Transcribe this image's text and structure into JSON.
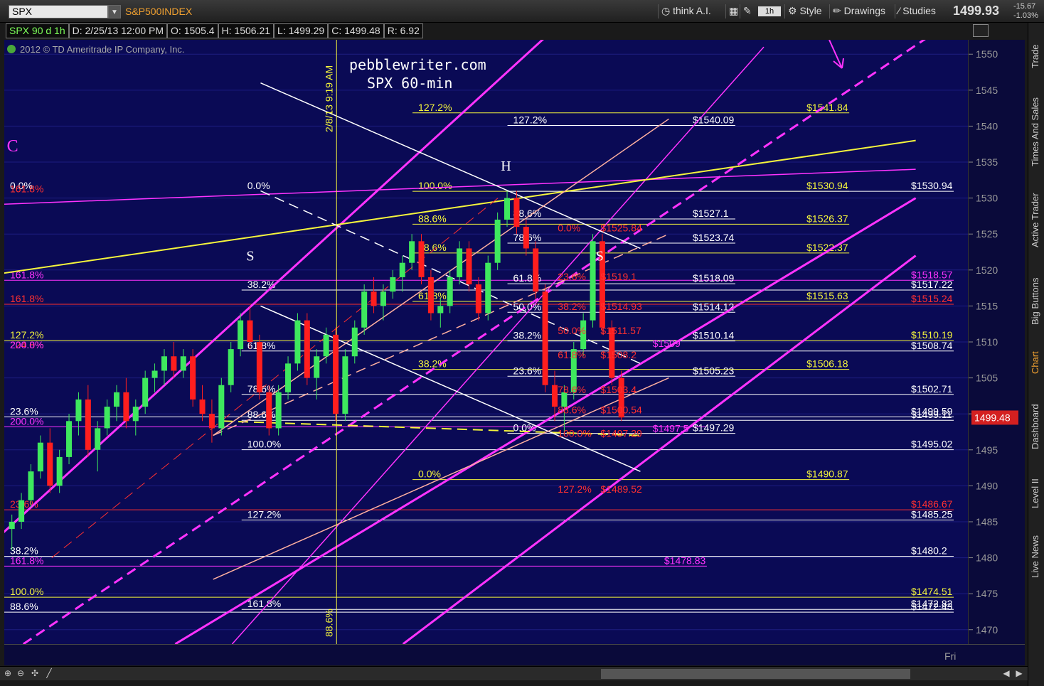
{
  "toolbar": {
    "symbol": "SPX",
    "symbol_name": "S&P500INDEX",
    "think_ai": "think A.I.",
    "interval": "1h",
    "style": "Style",
    "drawings": "Drawings",
    "studies": "Studies",
    "last_price": "1499.93",
    "change": "-15.67",
    "change_pct": "-1.03%"
  },
  "infobar": {
    "sym": "SPX 90 d 1h",
    "date": "D: 2/25/13 12:00 PM",
    "open": "O: 1505.4",
    "high": "H: 1506.21",
    "low": "L: 1499.29",
    "close": "C: 1499.48",
    "range": "R: 6.92"
  },
  "sidebar": [
    "Trade",
    "Times And Sales",
    "Active Trader",
    "Big Buttons",
    "Chart",
    "Dashboard",
    "Level II",
    "Live News"
  ],
  "colors": {
    "bg": "#0a0a55",
    "up": "#3ee85e",
    "down": "#ff1e1e",
    "magenta": "#ff33ff",
    "yellow": "#f5f53c",
    "white": "#ffffff",
    "salmon": "#ffb0a0",
    "red": "#ff3030",
    "current_price_box": "#d42020"
  },
  "chart_data": {
    "type": "candlestick",
    "title": "pebblewriter.com",
    "subtitle": "SPX 60-min",
    "copyright": "2012 © TD Ameritrade IP Company, Inc.",
    "x_axis_label": "Fri",
    "y_ticks": [
      1470,
      1475,
      1480,
      1485,
      1490,
      1495,
      1500,
      1505,
      1510,
      1515,
      1520,
      1525,
      1530,
      1535,
      1540,
      1545,
      1550
    ],
    "ylim": [
      1468,
      1552
    ],
    "current_price": 1499.48,
    "pattern_labels": [
      {
        "text": "C",
        "x": 0.27,
        "y": 1536.5,
        "color": "#ff33ff"
      },
      {
        "text": "S",
        "x": 25.5,
        "y": 1521.3,
        "color": "#ffffff"
      },
      {
        "text": "H",
        "x": 52.3,
        "y": 1533.8,
        "color": "#ffffff"
      },
      {
        "text": "S",
        "x": 62.3,
        "y": 1521.3,
        "color": "#ffffff"
      }
    ],
    "vertical_marker": {
      "label": "2/8/13 9:19 AM",
      "label_bottom": "88.6%",
      "x": 35.0
    },
    "candles": [
      [
        1484,
        1486,
        1481,
        1485
      ],
      [
        1485,
        1489,
        1484,
        1488
      ],
      [
        1488,
        1493,
        1487,
        1492
      ],
      [
        1492,
        1497,
        1491,
        1496
      ],
      [
        1496,
        1498,
        1489,
        1490
      ],
      [
        1490,
        1495,
        1489,
        1494
      ],
      [
        1494,
        1500,
        1493,
        1499
      ],
      [
        1499,
        1503,
        1497,
        1502
      ],
      [
        1502,
        1504,
        1494,
        1495
      ],
      [
        1495,
        1499,
        1492,
        1498
      ],
      [
        1498,
        1502,
        1497,
        1501
      ],
      [
        1501,
        1504,
        1499,
        1503
      ],
      [
        1503,
        1505,
        1498,
        1499
      ],
      [
        1499,
        1502,
        1497,
        1501
      ],
      [
        1501,
        1506,
        1500,
        1505
      ],
      [
        1505,
        1507,
        1503,
        1506
      ],
      [
        1506,
        1509,
        1504,
        1508
      ],
      [
        1508,
        1510,
        1505,
        1506
      ],
      [
        1506,
        1509,
        1505,
        1508
      ],
      [
        1508,
        1509,
        1501,
        1502
      ],
      [
        1502,
        1504,
        1499,
        1500
      ],
      [
        1500,
        1502,
        1496,
        1498
      ],
      [
        1498,
        1505,
        1497,
        1504
      ],
      [
        1504,
        1510,
        1503,
        1509
      ],
      [
        1509,
        1514,
        1508,
        1513
      ],
      [
        1513,
        1515,
        1509,
        1510
      ],
      [
        1510,
        1511,
        1502,
        1503
      ],
      [
        1503,
        1504,
        1497,
        1498
      ],
      [
        1498,
        1504,
        1497,
        1503
      ],
      [
        1503,
        1508,
        1502,
        1507
      ],
      [
        1507,
        1514,
        1506,
        1513
      ],
      [
        1513,
        1514,
        1504,
        1505
      ],
      [
        1505,
        1509,
        1502,
        1508
      ],
      [
        1508,
        1512,
        1507,
        1511
      ],
      [
        1511,
        1512,
        1499,
        1500
      ],
      [
        1500,
        1509,
        1499,
        1508
      ],
      [
        1508,
        1513,
        1507,
        1512
      ],
      [
        1512,
        1518,
        1511,
        1517
      ],
      [
        1517,
        1519,
        1514,
        1515
      ],
      [
        1515,
        1518,
        1513,
        1517
      ],
      [
        1517,
        1520,
        1516,
        1519
      ],
      [
        1519,
        1522,
        1517,
        1521
      ],
      [
        1521,
        1525,
        1520,
        1524
      ],
      [
        1524,
        1525,
        1518,
        1519
      ],
      [
        1519,
        1520,
        1513,
        1514
      ],
      [
        1514,
        1516,
        1512,
        1515
      ],
      [
        1515,
        1520,
        1514,
        1519
      ],
      [
        1519,
        1524,
        1518,
        1523
      ],
      [
        1523,
        1524,
        1517,
        1518
      ],
      [
        1518,
        1519,
        1513,
        1514
      ],
      [
        1514,
        1522,
        1513,
        1521
      ],
      [
        1521,
        1528,
        1520,
        1527
      ],
      [
        1527,
        1531,
        1526,
        1530
      ],
      [
        1530,
        1531,
        1525,
        1526
      ],
      [
        1526,
        1527,
        1522,
        1523
      ],
      [
        1523,
        1524,
        1516,
        1517
      ],
      [
        1517,
        1518,
        1503,
        1504
      ],
      [
        1504,
        1506,
        1499,
        1501
      ],
      [
        1501,
        1504,
        1497,
        1503
      ],
      [
        1503,
        1510,
        1502,
        1509
      ],
      [
        1509,
        1514,
        1508,
        1513
      ],
      [
        1513,
        1525,
        1512,
        1524
      ],
      [
        1524,
        1525,
        1511,
        1512
      ],
      [
        1512,
        1513,
        1504,
        1505
      ],
      [
        1505,
        1506,
        1499,
        1499.5
      ]
    ],
    "trendlines": [
      {
        "color": "#ff33ff",
        "width": 3,
        "dash": false,
        "points": [
          [
            -3,
            1480
          ],
          [
            60,
            1556
          ]
        ]
      },
      {
        "color": "#ff33ff",
        "width": 3,
        "dash": false,
        "points": [
          [
            18,
            1468
          ],
          [
            96,
            1530
          ]
        ]
      },
      {
        "color": "#ff33ff",
        "width": 3,
        "dash": false,
        "points": [
          [
            42,
            1468
          ],
          [
            96,
            1522
          ]
        ]
      },
      {
        "color": "#ff33ff",
        "width": 1.5,
        "dash": false,
        "points": [
          [
            24,
            1468
          ],
          [
            80,
            1551
          ]
        ]
      },
      {
        "color": "#ff33ff",
        "width": 3,
        "dash": true,
        "points": [
          [
            2,
            1468
          ],
          [
            98,
            1553
          ]
        ]
      },
      {
        "color": "#ff33ff",
        "width": 1.5,
        "dash": false,
        "points": [
          [
            -3,
            1529
          ],
          [
            96,
            1534
          ]
        ]
      },
      {
        "color": "#f5f53c",
        "width": 2,
        "dash": false,
        "points": [
          [
            -3,
            1519
          ],
          [
            96,
            1538
          ]
        ]
      },
      {
        "color": "#f5f53c",
        "width": 2,
        "dash": true,
        "points": [
          [
            23,
            1499
          ],
          [
            67,
            1497
          ]
        ]
      },
      {
        "color": "#ffffff",
        "width": 1.5,
        "dash": false,
        "points": [
          [
            27,
            1546
          ],
          [
            67,
            1523
          ]
        ]
      },
      {
        "color": "#ffffff",
        "width": 1.5,
        "dash": false,
        "points": [
          [
            27,
            1515
          ],
          [
            67,
            1492
          ]
        ]
      },
      {
        "color": "#ffffff",
        "width": 1.5,
        "dash": true,
        "points": [
          [
            27,
            1531
          ],
          [
            67,
            1507
          ]
        ]
      },
      {
        "color": "#ffb0a0",
        "width": 1.5,
        "dash": false,
        "points": [
          [
            22,
            1477
          ],
          [
            70,
            1505
          ]
        ]
      },
      {
        "color": "#ffb0a0",
        "width": 1.5,
        "dash": false,
        "points": [
          [
            22,
            1497
          ],
          [
            70,
            1541
          ]
        ]
      },
      {
        "color": "#ffb0a0",
        "width": 1.5,
        "dash": true,
        "points": [
          [
            22,
            1497
          ],
          [
            70,
            1525
          ]
        ]
      },
      {
        "color": "#ff3030",
        "width": 1,
        "dash": true,
        "points": [
          [
            5,
            1480
          ],
          [
            52,
            1530
          ]
        ]
      }
    ],
    "fib_levels": [
      {
        "price": 1541.84,
        "label": "$1541.84",
        "left_label": "127.2%",
        "color": "#f5f53c",
        "x1": 43,
        "x2": 89
      },
      {
        "price": 1540.09,
        "label": "$1540.09",
        "left_label": "127.2%",
        "color": "#ffffff",
        "x1": 53,
        "x2": 77
      },
      {
        "price": 1530.94,
        "label": "$1530.94",
        "left_label": "100.0%",
        "color": "#f5f53c",
        "x1": 43,
        "x2": 89
      },
      {
        "price": 1530.94,
        "label": "$1530.94",
        "left_label": "",
        "color": "#ffffff",
        "x1": 53,
        "x2": 100
      },
      {
        "price": 1527.1,
        "label": "$1527.1",
        "left_label": "88.6%",
        "color": "#ffffff",
        "x1": 53,
        "x2": 77
      },
      {
        "price": 1526.37,
        "label": "$1526.37",
        "left_label": "88.6%",
        "color": "#f5f53c",
        "x1": 43,
        "x2": 89
      },
      {
        "price": 1523.74,
        "label": "$1523.74",
        "left_label": "78.6%",
        "color": "#ffffff",
        "x1": 53,
        "x2": 77
      },
      {
        "price": 1522.37,
        "label": "$1522.37",
        "left_label": "78.6%",
        "color": "#f5f53c",
        "x1": 43,
        "x2": 89
      },
      {
        "price": 1518.57,
        "label": "$1518.57",
        "left_label": "161.8%",
        "color": "#ff33ff",
        "x1": 0,
        "x2": 100
      },
      {
        "price": 1518.09,
        "label": "$1518.09",
        "left_label": "61.8%",
        "color": "#ffffff",
        "x1": 53,
        "x2": 77
      },
      {
        "price": 1517.22,
        "label": "$1517.22",
        "left_label": "38.2%",
        "color": "#ffffff",
        "x1": 25,
        "x2": 100
      },
      {
        "price": 1515.63,
        "label": "$1515.63",
        "left_label": "61.8%",
        "color": "#f5f53c",
        "x1": 43,
        "x2": 89
      },
      {
        "price": 1515.24,
        "label": "$1515.24",
        "left_label": "161.8%",
        "color": "#ff3030",
        "x1": 0,
        "x2": 100
      },
      {
        "price": 1514.12,
        "label": "$1514.12",
        "left_label": "50.0%",
        "color": "#ffffff",
        "x1": 53,
        "x2": 77
      },
      {
        "price": 1510.19,
        "label": "$1510.19",
        "left_label": "127.2%",
        "color": "#f5f53c",
        "x1": 0,
        "x2": 100
      },
      {
        "price": 1510.14,
        "label": "$1510.14",
        "left_label": "38.2%",
        "color": "#ffffff",
        "x1": 53,
        "x2": 77
      },
      {
        "price": 1508.74,
        "label": "$1508.74",
        "left_label": "61.8%",
        "color": "#ffffff",
        "x1": 25,
        "x2": 100
      },
      {
        "price": 1506.18,
        "label": "$1506.18",
        "left_label": "38.2%",
        "color": "#f5f53c",
        "x1": 43,
        "x2": 89
      },
      {
        "price": 1505.23,
        "label": "$1505.23",
        "left_label": "23.6%",
        "color": "#ffffff",
        "x1": 53,
        "x2": 77
      },
      {
        "price": 1502.71,
        "label": "$1502.71",
        "left_label": "78.6%",
        "color": "#ffffff",
        "x1": 25,
        "x2": 100
      },
      {
        "price": 1499.59,
        "label": "$1499.59",
        "left_label": "23.6%",
        "color": "#ffffff",
        "x1": 0,
        "x2": 100
      },
      {
        "price": 1499.11,
        "label": "$1499.11",
        "left_label": "88.6%",
        "color": "#ffffff",
        "x1": 25,
        "x2": 100
      },
      {
        "price": 1498.2,
        "label": "",
        "left_label": "200.0%",
        "color": "#ff33ff",
        "x1": 0,
        "x2": 74
      },
      {
        "price": 1497.29,
        "label": "$1497.29",
        "left_label": "0.0%",
        "color": "#ffffff",
        "x1": 53,
        "x2": 77
      },
      {
        "price": 1495.02,
        "label": "$1495.02",
        "left_label": "100.0%",
        "color": "#ffffff",
        "x1": 25,
        "x2": 100
      },
      {
        "price": 1490.87,
        "label": "$1490.87",
        "left_label": "0.0%",
        "color": "#f5f53c",
        "x1": 43,
        "x2": 89
      },
      {
        "price": 1486.67,
        "label": "$1486.67",
        "left_label": "23.6%",
        "color": "#ff3030",
        "x1": 0,
        "x2": 100
      },
      {
        "price": 1485.25,
        "label": "$1485.25",
        "left_label": "127.2%",
        "color": "#ffffff",
        "x1": 25,
        "x2": 100
      },
      {
        "price": 1480.2,
        "label": "$1480.2",
        "left_label": "38.2%",
        "color": "#ffffff",
        "x1": 0,
        "x2": 100
      },
      {
        "price": 1478.83,
        "label": "$1478.83",
        "left_label": "161.8%",
        "color": "#ff33ff",
        "x1": 0,
        "x2": 74
      },
      {
        "price": 1474.51,
        "label": "$1474.51",
        "left_label": "100.0%",
        "color": "#f5f53c",
        "x1": 0,
        "x2": 100
      },
      {
        "price": 1472.82,
        "label": "$1472.82",
        "left_label": "161.8%",
        "color": "#ffffff",
        "x1": 25,
        "x2": 100
      },
      {
        "price": 1472.43,
        "label": "$1472.43",
        "left_label": "88.6%",
        "color": "#ffffff",
        "x1": 0,
        "x2": 100
      }
    ],
    "left_edge_labels": [
      {
        "price": 1530.94,
        "label": "0.0%",
        "color": "#ffffff"
      },
      {
        "price": 1530.5,
        "label": "161.8%",
        "color": "#ff3030"
      },
      {
        "price": 1530.94,
        "label": "0.0%",
        "color": "#ffffff",
        "x": 25
      }
    ],
    "red_fib_labels": [
      {
        "price": 1525.84,
        "label": "$1525.84",
        "pct": "0.0%"
      },
      {
        "price": 1519.1,
        "label": "$1519.1",
        "pct": "23.6%"
      },
      {
        "price": 1514.93,
        "label": "$1514.93",
        "pct": "38.2%"
      },
      {
        "price": 1511.57,
        "label": "$1511.57",
        "pct": "50.0%"
      },
      {
        "price": 1508.2,
        "label": "$1508.2",
        "pct": "61.8%"
      },
      {
        "price": 1503.4,
        "label": "$1503.4",
        "pct": "78.6%"
      },
      {
        "price": 1500.54,
        "label": "$1500.54",
        "pct": "88.6%"
      },
      {
        "price": 1497.29,
        "label": "$1497.29",
        "pct": "100.0%"
      },
      {
        "price": 1489.52,
        "label": "$1489.52",
        "pct": "127.2%"
      }
    ],
    "magenta_mid_labels": [
      {
        "price": 1509.8,
        "label": "$1509"
      },
      {
        "price": 1498.0,
        "label": "$1497.5"
      }
    ],
    "left_extra_labels": [
      {
        "price": 1509.6,
        "label": "224.8%",
        "color": "#ff3030"
      },
      {
        "price": 1509.6,
        "label": "200.0%",
        "color": "#ff33ff",
        "offset": 0
      }
    ]
  }
}
